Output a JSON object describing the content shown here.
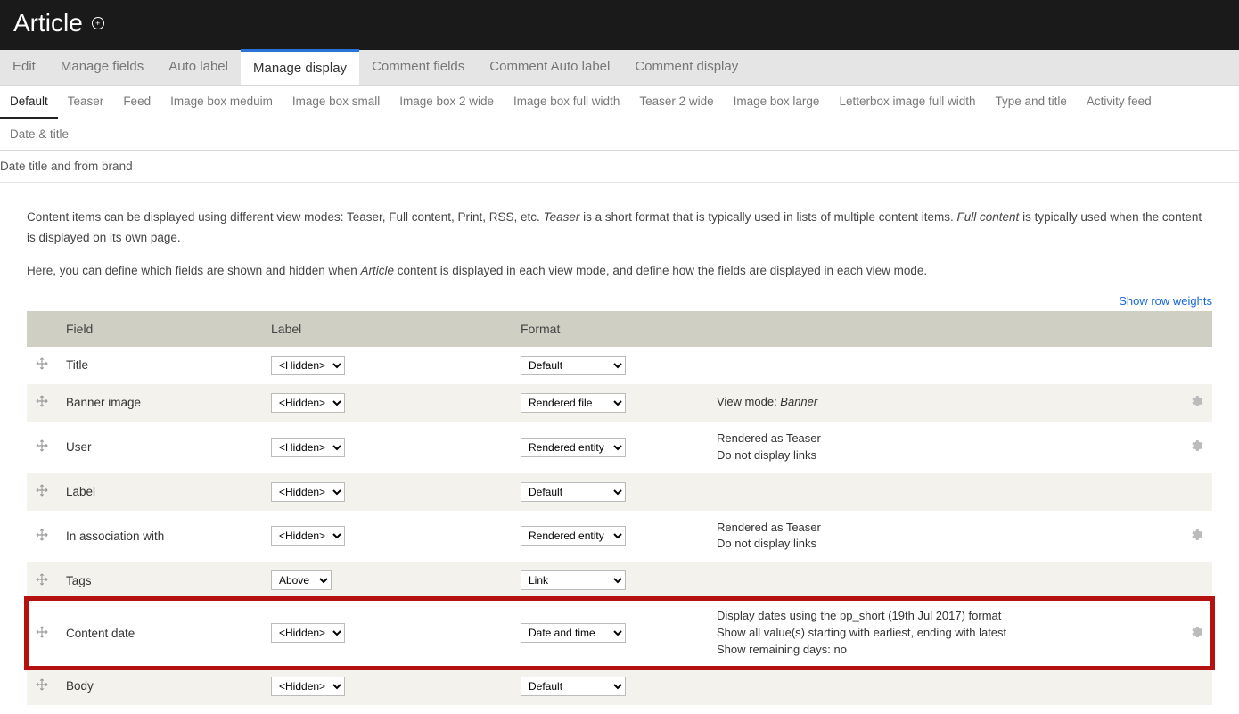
{
  "header": {
    "title": "Article"
  },
  "primary_tabs": [
    {
      "label": "Edit"
    },
    {
      "label": "Manage fields"
    },
    {
      "label": "Auto label"
    },
    {
      "label": "Manage display",
      "active": true
    },
    {
      "label": "Comment fields"
    },
    {
      "label": "Comment Auto label"
    },
    {
      "label": "Comment display"
    }
  ],
  "secondary_tabs": [
    {
      "label": "Default",
      "active": true
    },
    {
      "label": "Teaser"
    },
    {
      "label": "Feed"
    },
    {
      "label": "Image box meduim"
    },
    {
      "label": "Image box small"
    },
    {
      "label": "Image box 2 wide"
    },
    {
      "label": "Image box full width"
    },
    {
      "label": "Teaser 2 wide"
    },
    {
      "label": "Image box large"
    },
    {
      "label": "Letterbox image full width"
    },
    {
      "label": "Type and title"
    },
    {
      "label": "Activity feed"
    },
    {
      "label": "Date & title"
    }
  ],
  "tertiary_tabs": [
    {
      "label": "Date title and from brand"
    }
  ],
  "intro": {
    "p1_a": "Content items can be displayed using different view modes: Teaser, Full content, Print, RSS, etc. ",
    "p1_t": "Teaser",
    "p1_b": " is a short format that is typically used in lists of multiple content items. ",
    "p1_f": "Full content",
    "p1_c": " is typically used when the content is displayed on its own page.",
    "p2_a": "Here, you can define which fields are shown and hidden when ",
    "p2_e": "Article",
    "p2_b": " content is displayed in each view mode, and define how the fields are displayed in each view mode."
  },
  "links": {
    "show_row_weights": "Show row weights"
  },
  "table": {
    "headers": {
      "field": "Field",
      "label": "Label",
      "format": "Format"
    },
    "rows": [
      {
        "field": "Title",
        "label": "<Hidden>",
        "format": "Default",
        "summary": "",
        "gear": false,
        "odd": false
      },
      {
        "field": "Banner image",
        "label": "<Hidden>",
        "format": "Rendered file",
        "summary": "View mode: <em>Banner</em>",
        "gear": true,
        "odd": true
      },
      {
        "field": "User",
        "label": "<Hidden>",
        "format": "Rendered entity",
        "summary": "Rendered as Teaser<br>Do not display links",
        "gear": true,
        "odd": false
      },
      {
        "field": "Label",
        "label": "<Hidden>",
        "format": "Default",
        "summary": "",
        "gear": false,
        "odd": true
      },
      {
        "field": "In association with",
        "label": "<Hidden>",
        "format": "Rendered entity",
        "summary": "Rendered as Teaser<br>Do not display links",
        "gear": true,
        "odd": false
      },
      {
        "field": "Tags",
        "label": "Above",
        "format": "Link",
        "summary": "",
        "gear": false,
        "odd": true
      },
      {
        "field": "Content date",
        "label": "<Hidden>",
        "format": "Date and time",
        "summary": "Display dates using the pp_short (19th Jul 2017) format<br>Show all value(s) starting with earliest, ending with latest<br>Show remaining days: no",
        "gear": true,
        "odd": false,
        "highlight": true
      },
      {
        "field": "Body",
        "label": "<Hidden>",
        "format": "Default",
        "summary": "",
        "gear": false,
        "odd": true
      }
    ]
  }
}
